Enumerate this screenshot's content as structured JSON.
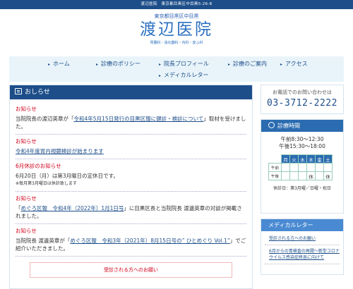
{
  "topbar": {
    "text": "渡辺医院　東京都目黒区中目黒5-26-8"
  },
  "header": {
    "address": "東京都目黒区中目黒",
    "title": "渡辺医院",
    "tags": "胃腸科・消化器科・内科・皮ふ科"
  },
  "nav": {
    "items": [
      "ホーム",
      "診療のポリシー",
      "院長プロフィール",
      "診療のご案内",
      "アクセス",
      "メディカルレター"
    ]
  },
  "main": {
    "heading": "おしらせ",
    "entries": [
      {
        "title": "お知らせ",
        "pre": "当院院長の渡辺英章が「",
        "link": "令和4年5月15日発行の目黒区報に健診・検診について",
        "post": "」取材を受けました。"
      },
      {
        "title": "お知らせ",
        "link": "令和4年度胃内視鏡検診が始まります"
      },
      {
        "title": "6月休診のお知らせ",
        "line1": "6月20日（月）は第3月曜日の定休日です。",
        "line2": "※毎月第3月曜日は休診致します"
      },
      {
        "title": "お知らせ",
        "pre": "「",
        "link": "めぐろ区報　令和4年（2022年）1月1日号",
        "post": "」に目黒区長と当院院長 渡邊英章の対談が掲載されました。"
      },
      {
        "title": "お知らせ",
        "pre": "当院院長 渡邊英章が「",
        "link": "めぐろ区報　令和3年（2021年）8月15日号の” ひとめぐり Vol.1”",
        "post": "」でご紹介いただきました。"
      }
    ],
    "notice": "受診される方へのお願い"
  },
  "sidebar": {
    "phone_label": "お電話でのお問い合わせは",
    "phone": "03-3712-2222",
    "hours_heading": "診療時間",
    "am": "午前8:30～12:30",
    "pm": "午後15:30～18:00",
    "days": [
      "月",
      "火",
      "水",
      "木",
      "金",
      "土"
    ],
    "rows": [
      {
        "label": "午前",
        "cells": [
          "",
          "",
          "",
          "",
          "",
          ""
        ]
      },
      {
        "label": "午後",
        "cells": [
          "",
          "",
          "",
          "休",
          "",
          "休"
        ]
      }
    ],
    "holiday": "休診日：第3月曜／日曜・祝日",
    "letter_heading": "メディカルレター",
    "letters": [
      "受診される方へのお願い",
      "6月からの胃検査の再開〜新型コロナウイルス感染症終息に向けて"
    ]
  },
  "colors": {
    "navy": "#1d4e89",
    "blue": "#2a6fc1",
    "red": "#d0021b",
    "nav_bg": "#e9f4fa"
  }
}
